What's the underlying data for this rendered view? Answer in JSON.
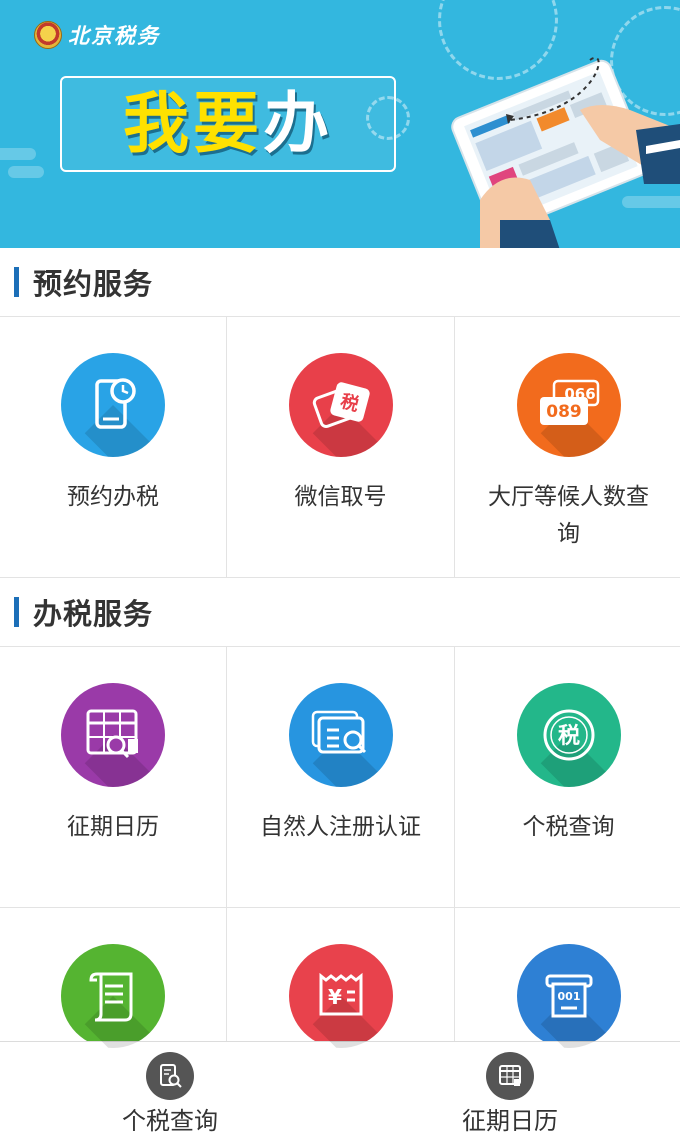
{
  "banner": {
    "logo_text": "北京税务",
    "title_part1": "我要",
    "title_part2": "办"
  },
  "sections": [
    {
      "title": "预约服务",
      "items": [
        {
          "label": "预约办税",
          "icon": "phone-clock-icon",
          "color": "#29a3e6"
        },
        {
          "label": "微信取号",
          "icon": "wechat-ticket-icon",
          "color": "#e8404a"
        },
        {
          "label": "大厅等候人数查询",
          "icon": "queue-number-icon",
          "color": "#f26b1d",
          "display_numbers": [
            "066",
            "089"
          ]
        }
      ]
    },
    {
      "title": "办税服务",
      "items": [
        {
          "label": "征期日历",
          "icon": "calendar-search-icon",
          "color": "#9a3aa8"
        },
        {
          "label": "自然人注册认证",
          "icon": "id-card-search-icon",
          "color": "#2795e0"
        },
        {
          "label": "个税查询",
          "icon": "tax-seal-icon",
          "color": "#23b78a",
          "glyph": "税"
        },
        {
          "label": "",
          "icon": "scroll-document-icon",
          "color": "#55b431"
        },
        {
          "label": "",
          "icon": "receipt-yuan-icon",
          "color": "#e8424c",
          "glyph": "¥"
        },
        {
          "label": "",
          "icon": "queue-ticket-icon",
          "color": "#2e80d4",
          "display_number": "001"
        }
      ]
    }
  ],
  "tabbar": {
    "tabs": [
      {
        "label": "个税查询",
        "icon": "search-document-icon"
      },
      {
        "label": "征期日历",
        "icon": "calendar-icon"
      }
    ]
  }
}
